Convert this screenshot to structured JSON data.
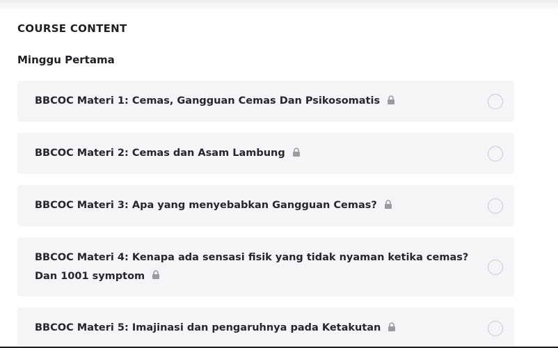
{
  "course_content": {
    "title": "COURSE CONTENT",
    "week_title": "Minggu Pertama",
    "lessons": [
      {
        "label": "BBCOC Materi 1: Cemas, Gangguan Cemas Dan Psikosomatis",
        "locked_icon": "lock-icon",
        "completed": false
      },
      {
        "label": "BBCOC Materi 2: Cemas dan Asam Lambung",
        "locked_icon": "lock-icon",
        "completed": false
      },
      {
        "label": "BBCOC Materi 3: Apa yang menyebabkan Gangguan Cemas?",
        "locked_icon": "lock-icon",
        "completed": false
      },
      {
        "label": "BBCOC Materi 4: Kenapa ada sensasi fisik yang tidak nyaman ketika cemas? Dan 1001 symptom",
        "locked_icon": "lock-icon",
        "completed": false
      },
      {
        "label": "BBCOC Materi 5: Imajinasi dan pengaruhnya pada Ketakutan",
        "locked_icon": "lock-icon",
        "completed": false
      }
    ]
  },
  "colors": {
    "item_background": "#f5f5f8",
    "text": "#26262c",
    "lock": "#9a9aa0",
    "circle_border": "#c9c9cf"
  }
}
